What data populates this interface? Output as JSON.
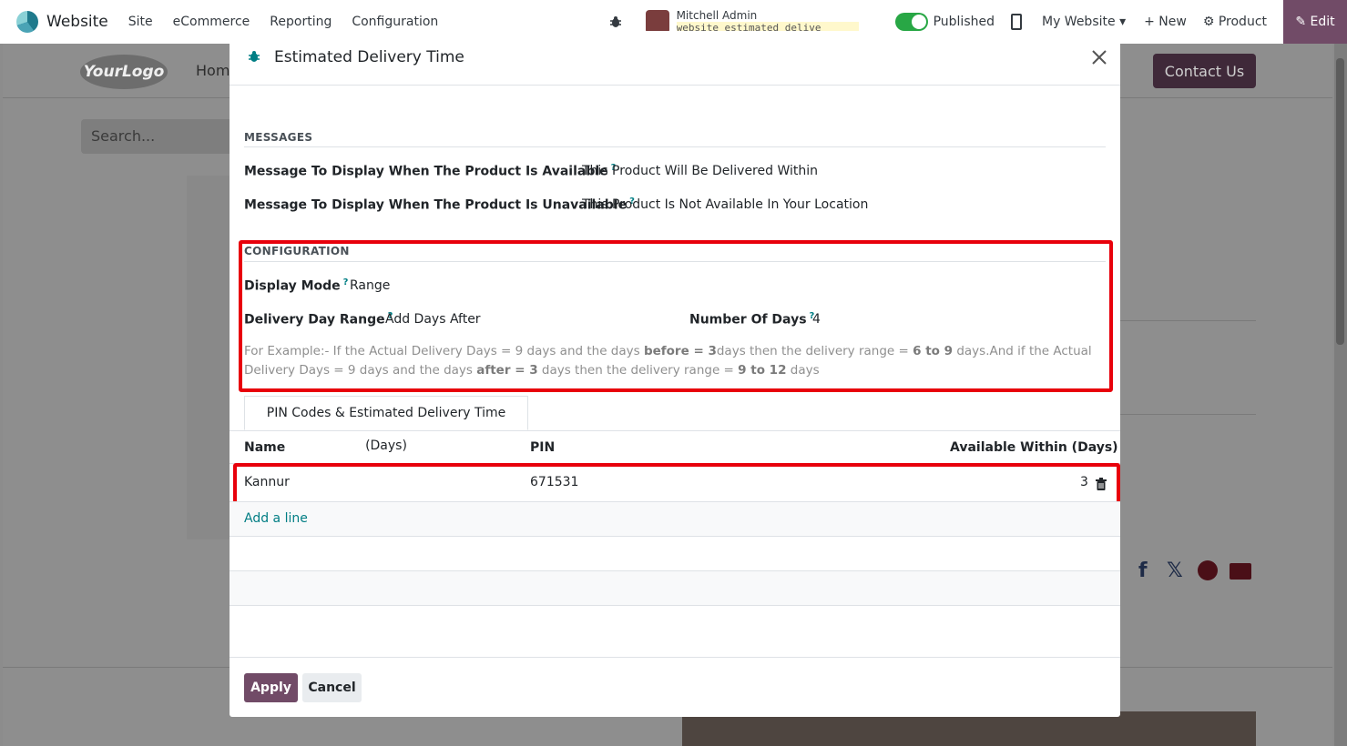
{
  "topbar": {
    "app_name": "Website",
    "menu": [
      "Site",
      "eCommerce",
      "Reporting",
      "Configuration"
    ],
    "user_name": "Mitchell Admin",
    "database": "website_estimated_delive",
    "published_label": "Published",
    "website_label": "My Website",
    "new_label": "New",
    "product_label": "Product",
    "edit_label": "Edit"
  },
  "site": {
    "logo_text": "YourLogo",
    "home_link": "Home",
    "contact_button": "Contact Us",
    "search_placeholder": "Search..."
  },
  "modal": {
    "title": "Estimated Delivery Time",
    "messages_section": "MESSAGES",
    "available_label": "Message To Display When The Product Is Available",
    "available_value": "This Product Will Be Delivered Within",
    "unavailable_label": "Message To Display When The Product Is Unavailable",
    "unavailable_value": "This Product Is Not Available In Your Location",
    "configuration_section": "CONFIGURATION",
    "display_mode_label": "Display Mode",
    "display_mode_value": "Range",
    "day_range_label": "Delivery Day Range",
    "day_range_value": "Add Days After",
    "number_of_days_label": "Number Of Days",
    "number_of_days_value": "4",
    "help_q": "?",
    "help": {
      "p1": "For Example:- If the Actual Delivery Days = 9 days and the days ",
      "b1": "before = 3",
      "p2": "days then the delivery range = ",
      "b2": "6 to 9",
      "p3": " days.And if the Actual Delivery Days = 9 days and the days ",
      "b3": "after = 3",
      "p4": " days then the delivery range = ",
      "b4": "9 to 12",
      "p5": " days"
    },
    "tab_label": "PIN Codes & Estimated Delivery Time (Days)",
    "columns": [
      "Name",
      "PIN",
      "Available Within (Days)"
    ],
    "rows": [
      {
        "name": "Kannur",
        "pin": "671531",
        "days": "3"
      }
    ],
    "add_line": "Add a line",
    "apply_button": "Apply",
    "cancel_button": "Cancel"
  },
  "colors": {
    "brand": "#714b67",
    "link": "#017e84",
    "highlight": "#e8000b"
  }
}
